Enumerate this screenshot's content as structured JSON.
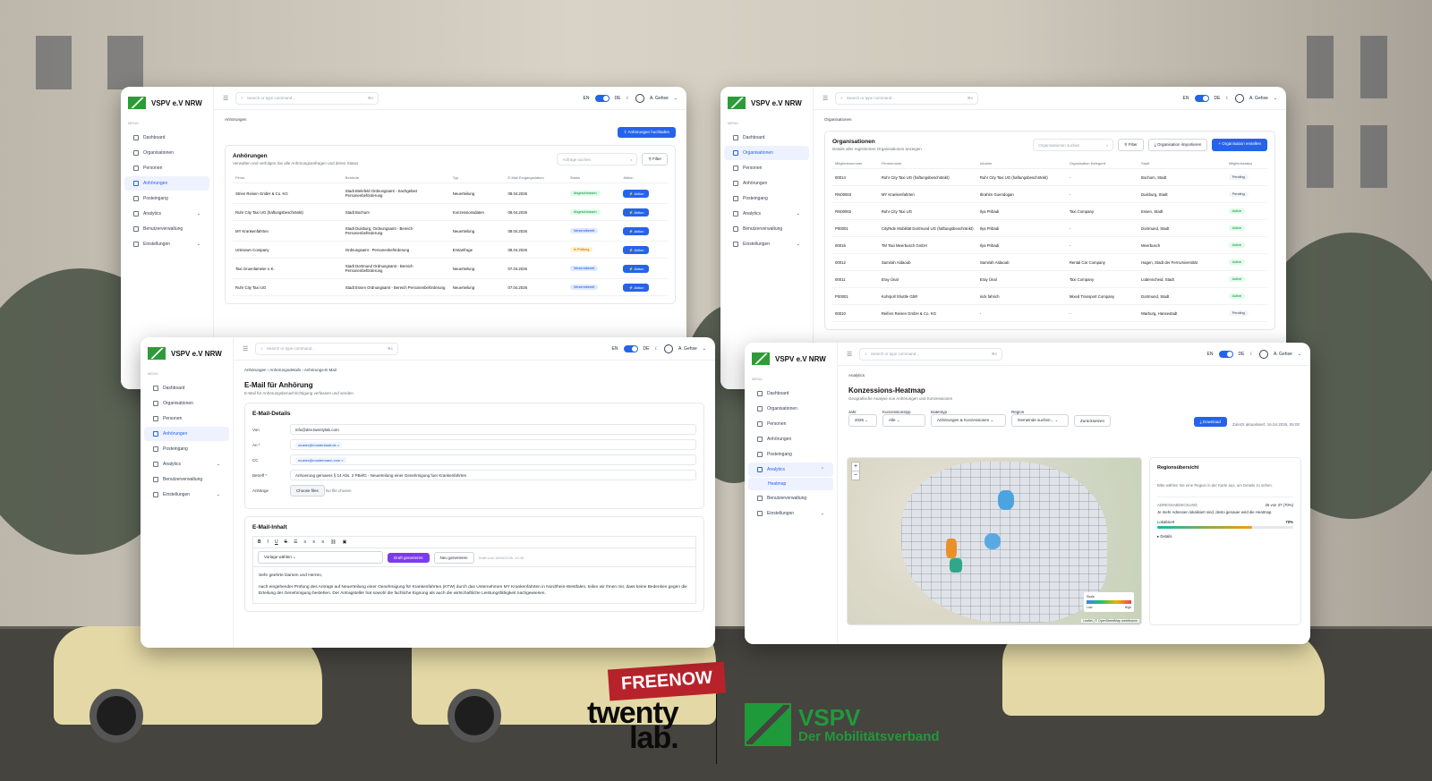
{
  "brand": {
    "name": "VSPV e.V NRW",
    "menu_label": "MENÜ"
  },
  "nav": {
    "dashboard": "Dashboard",
    "organisationen": "Organisationen",
    "personen": "Personen",
    "anhoerungen": "Anhörungen",
    "posteingang": "Posteingang",
    "analytics": "Analytics",
    "heatmap": "Heatmap",
    "benutzerverwaltung": "Benutzerverwaltung",
    "einstellungen": "Einstellungen"
  },
  "topbar": {
    "search_placeholder": "Search or type command...",
    "shortcut": "⌘K",
    "lang_en": "EN",
    "lang_de": "DE",
    "user": "A. Gehse"
  },
  "w1": {
    "crumb": "Anhörungen",
    "upload_button": "Anhörungen hochladen",
    "title": "Anhörungen",
    "subtitle": "Verwalten und verfolgen Sie alle Anhörungsanfragen und deren Status",
    "search_placeholder": "Anfrage suchen",
    "filter": "Filter",
    "columns": [
      "Firma",
      "Behörde",
      "Typ",
      "E-Mail Eingangsdatum",
      "Status",
      "Aktion"
    ],
    "rows": [
      {
        "firma": "Strien Reisen GmbH & Co. KG",
        "behoerde": "Stadt Bielefeld Ordnungsamt - Sachgebiet Personenbeförderung",
        "typ": "Neuerteilung",
        "datum": "08.04.2026",
        "status": "Abgeschlossen",
        "cls": "b-green"
      },
      {
        "firma": "Ruhr City Taxi UG (haftungsbeschränkt)",
        "behoerde": "Stadt Bochum",
        "typ": "Konzessionsdaten",
        "datum": "08.04.2026",
        "status": "Abgeschlossen",
        "cls": "b-green"
      },
      {
        "firma": "MY Krankenfahrten",
        "behoerde": "Stadt Duisburg, Ordnungsamt - Bereich Personenbeförderung",
        "typ": "Neuerteilung",
        "datum": "08.04.2026",
        "status": "Versendbereit",
        "cls": "b-blue"
      },
      {
        "firma": "Unknown Company",
        "behoerde": "Ordnungsamt - Personenbeförderung",
        "typ": "Erstanfrage",
        "datum": "08.04.2026",
        "status": "In Prüfung",
        "cls": "b-yellow"
      },
      {
        "firma": "Taxi Gruenlameier e.K.",
        "behoerde": "Stadt Dortmund Ordnungsamt - Bereich Personenbeförderung",
        "typ": "Neuerteilung",
        "datum": "07.04.2026",
        "status": "Versendbereit",
        "cls": "b-blue"
      },
      {
        "firma": "Ruhr City Taxi UG",
        "behoerde": "Stadt Essen Ordnungsamt - Bereich Personenbeförderung",
        "typ": "Neuerteilung",
        "datum": "07.04.2026",
        "status": "Versendbereit",
        "cls": "b-blue"
      }
    ],
    "action_label": "Aktion"
  },
  "w2": {
    "crumb": "Organisationen",
    "title": "Organisationen",
    "subtitle": "Details aller registrierten Organisationen anzeigen",
    "search_placeholder": "Organisationen suchen",
    "filter": "Filter",
    "import_button": "Organisation importieren",
    "create_button": "Organisation erstellen",
    "columns": [
      "Mitgliedsnummer",
      "Firmenname",
      "Inhaber",
      "Organisation Kategorie",
      "Stadt",
      "Mitgliedsstatus"
    ],
    "rows": [
      {
        "nr": "00014",
        "name": "Ruhr City Taxi UG (haftungsbeschränkt)",
        "inhaber": "Ruhr City Taxi UG (haftungsbeschränkt)",
        "kat": "-",
        "stadt": "Bochum, Stadt",
        "status": "Pending",
        "cls": "b-gray"
      },
      {
        "nr": "RN00003",
        "name": "MY Krankenfahrten",
        "inhaber": "Ibrahim Guendogan",
        "kat": "-",
        "stadt": "Duisburg, Stadt",
        "status": "Pending",
        "cls": "b-gray"
      },
      {
        "nr": "RN00002",
        "name": "Ruhr City Taxi UG",
        "inhaber": "Ilya Pribadi",
        "kat": "Taxi Company",
        "stadt": "Essen, Stadt",
        "status": "Active",
        "cls": "b-green"
      },
      {
        "nr": "P00001",
        "name": "CityRide Mobilität Dortmund UG (haftungsbeschränkt)",
        "inhaber": "Ilya Pribadi",
        "kat": "-",
        "stadt": "Dortmund, Stadt",
        "status": "Active",
        "cls": "b-green"
      },
      {
        "nr": "00015",
        "name": "TM Taxi Meerbusch GmbH",
        "inhaber": "Ilya Pribadi",
        "kat": "-",
        "stadt": "Meerbusch",
        "status": "Active",
        "cls": "b-green"
      },
      {
        "nr": "00012",
        "name": "Samirah Aldaoub",
        "inhaber": "Samirah Aldaoub",
        "kat": "Rental Car Company",
        "stadt": "Hagen, Stadt der FernUniversität",
        "status": "Active",
        "cls": "b-green"
      },
      {
        "nr": "00011",
        "name": "Eray Ünal",
        "inhaber": "Eray Ünal",
        "kat": "Taxi Company",
        "stadt": "Lüdenscheid, Stadt",
        "status": "Active",
        "cls": "b-green"
      },
      {
        "nr": "P00001",
        "name": "Kohrpoll Shuttle GbR",
        "inhaber": "nick fahrich",
        "kat": "Mixed Transport Company",
        "stadt": "Dortmund, Stadt",
        "status": "Active",
        "cls": "b-green"
      },
      {
        "nr": "00010",
        "name": "Reifers Reisen GmbH & Co. KG",
        "inhaber": "-",
        "kat": "-",
        "stadt": "Warburg, Hansestadt",
        "status": "Pending",
        "cls": "b-gray"
      }
    ]
  },
  "w3": {
    "crumb1": "Anhörungen",
    "crumb2": "Anhörungsdetails",
    "crumb3": "Anhörungs-E-Mail",
    "title": "E-Mail für Anhörung",
    "subtitle": "E-Mail für Anhörungsbenachrichtigung verfassen und senden",
    "section1": "E-Mail-Details",
    "von_label": "Von",
    "von_value": "info@dev.twentylab.com",
    "an_label": "An *",
    "an_chip": "muster@musterstadt.de ×",
    "cc_label": "CC",
    "cc_chip": "muster@mustermann.com ×",
    "betreff_label": "Betreff *",
    "betreff_value": "Anhoerung gemaess § 14 Abs. 2 PBefG - Neuerteilung einer Genehmigung fuer Krankenfahrten",
    "anhaenge_label": "Anhänge",
    "choose_files": "Choose files",
    "no_file": "No file chosen",
    "section2": "E-Mail-Inhalt",
    "template_select": "Vorlage wählen",
    "draft_button": "Draft generieren",
    "regen_button": "Neu generieren",
    "draft_note": "Draft vom 16/04/2026, 10:49",
    "greeting": "Sehr geehrte Damen und Herren,",
    "body": "nach eingehender Prüfung des Antrags auf Neuerteilung einer Genehmigung für Krankenfahrten (KTW) durch das Unternehmen MY Krankenfahrten in Nordrhein-Westfalen, teilen wir Ihnen mit, dass keine Bedenken gegen die Erteilung der Genehmigung bestehen. Der Antragsteller hat sowohl die fachliche Eignung als auch die wirtschaftliche Leistungsfähigkeit nachgewiesen."
  },
  "w4": {
    "crumb": "Analytics",
    "title": "Konzessions-Heatmap",
    "subtitle": "Geografische Analyse von Anhörungen und Konzessionen",
    "f_jahr": "Jahr",
    "v_jahr": "2026",
    "f_typ": "Konzessionstyp",
    "v_typ": "Alle",
    "f_daten": "Datentyp",
    "v_daten": "Anhörungen & Konzessionen",
    "f_region": "Region",
    "v_region": "Gemeinde suchen...",
    "reset": "Zurücksetzen",
    "download": "Download",
    "updated": "Zuletzt aktualisiert: 16.04.2026, 05:00",
    "zoom_in": "+",
    "zoom_out": "−",
    "legend_title": "Skala",
    "legend_low": "Low",
    "legend_high": "High",
    "attribution": "Leaflet | © OpenStreetMap contributors",
    "side_title": "Regionsübersicht",
    "side_text": "Bitte wählen Sie eine Region in der Karte aus, um Details zu sehen.",
    "stat_label": "ADRESSABDECKUNG",
    "stat_value": "26 von 37 (70%)",
    "stat_text": "Je mehr Adressen lokalisiert sind, desto genauer wird die Heatmap.",
    "loc_label": "Lokalisiert",
    "loc_value": "70%",
    "loc_fraction": 0.7,
    "details": "▸ Details"
  },
  "footer": {
    "twenty": "twenty",
    "lab": "lab.",
    "vspv": "VSPV",
    "vspv_sub": "Der Mobilitätsverband"
  },
  "background": {
    "sign": "FREENOW"
  }
}
